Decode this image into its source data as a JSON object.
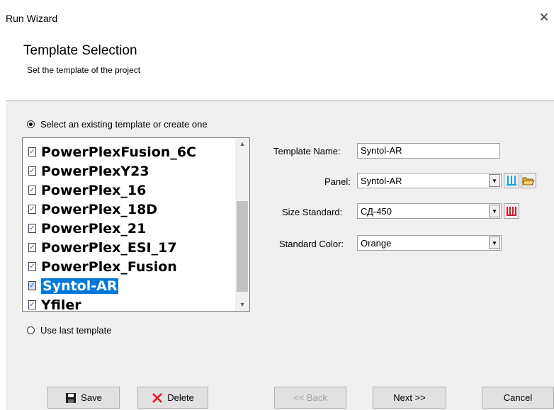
{
  "window": {
    "title": "Run Wizard",
    "close_glyph": "✕"
  },
  "header": {
    "title": "Template Selection",
    "subtitle": "Set the template of the project"
  },
  "options": {
    "existing_label": "Select an existing template or create one",
    "last_label": "Use last template",
    "selected": "existing"
  },
  "templates": {
    "items": [
      "PowerPlexFusion_6C",
      "PowerPlexY23",
      "PowerPlex_16",
      "PowerPlex_18D",
      "PowerPlex_21",
      "PowerPlex_ESI_17",
      "PowerPlex_Fusion",
      "Syntol-AR",
      "Yfiler"
    ],
    "selected_index": 7
  },
  "form": {
    "template_name": {
      "label": "Template Name:",
      "value": "Syntol-AR"
    },
    "panel": {
      "label": "Panel:",
      "value": "Syntol-AR"
    },
    "size_standard": {
      "label": "Size Standard:",
      "value": "СД-450"
    },
    "standard_color": {
      "label": "Standard Color:",
      "value": "Orange"
    }
  },
  "buttons": {
    "save": "Save",
    "delete": "Delete",
    "back": "<< Back",
    "next": "Next >>",
    "cancel": "Cancel"
  },
  "colors": {
    "selection": "#0078d7",
    "delete_icon": "#e81123",
    "panel_bars": "#1a9fd6",
    "size_bars": "#d11a2a",
    "folder": "#e8b73a"
  }
}
